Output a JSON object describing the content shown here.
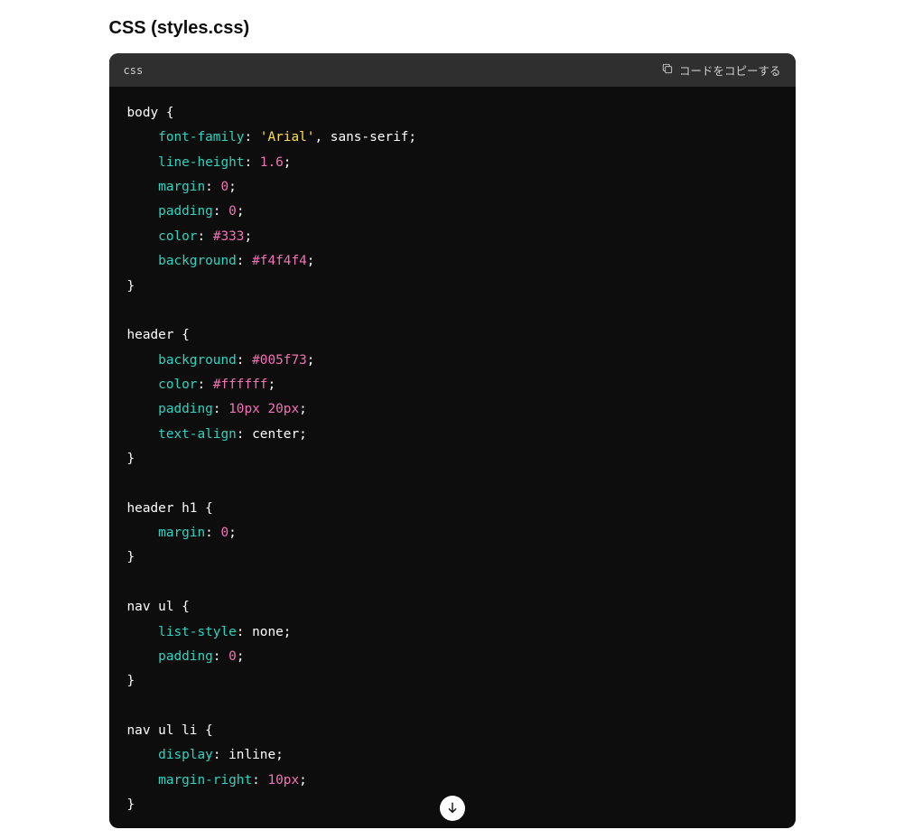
{
  "heading": "CSS (styles.css)",
  "codeblock": {
    "language": "css",
    "copy_label": "コードをコピーする",
    "lines": [
      [
        {
          "t": "sel",
          "v": "body {"
        }
      ],
      [
        {
          "t": "indent",
          "v": "    "
        },
        {
          "t": "prop",
          "v": "font-family"
        },
        {
          "t": "punc",
          "v": ": "
        },
        {
          "t": "str",
          "v": "'Arial'"
        },
        {
          "t": "punc",
          "v": ", sans-serif;"
        }
      ],
      [
        {
          "t": "indent",
          "v": "    "
        },
        {
          "t": "prop",
          "v": "line-height"
        },
        {
          "t": "punc",
          "v": ": "
        },
        {
          "t": "num",
          "v": "1.6"
        },
        {
          "t": "punc",
          "v": ";"
        }
      ],
      [
        {
          "t": "indent",
          "v": "    "
        },
        {
          "t": "prop",
          "v": "margin"
        },
        {
          "t": "punc",
          "v": ": "
        },
        {
          "t": "num",
          "v": "0"
        },
        {
          "t": "punc",
          "v": ";"
        }
      ],
      [
        {
          "t": "indent",
          "v": "    "
        },
        {
          "t": "prop",
          "v": "padding"
        },
        {
          "t": "punc",
          "v": ": "
        },
        {
          "t": "num",
          "v": "0"
        },
        {
          "t": "punc",
          "v": ";"
        }
      ],
      [
        {
          "t": "indent",
          "v": "    "
        },
        {
          "t": "prop",
          "v": "color"
        },
        {
          "t": "punc",
          "v": ": "
        },
        {
          "t": "num",
          "v": "#333"
        },
        {
          "t": "punc",
          "v": ";"
        }
      ],
      [
        {
          "t": "indent",
          "v": "    "
        },
        {
          "t": "prop",
          "v": "background"
        },
        {
          "t": "punc",
          "v": ": "
        },
        {
          "t": "num",
          "v": "#f4f4f4"
        },
        {
          "t": "punc",
          "v": ";"
        }
      ],
      [
        {
          "t": "sel",
          "v": "}"
        }
      ],
      [
        {
          "t": "blank",
          "v": " "
        }
      ],
      [
        {
          "t": "sel",
          "v": "header {"
        }
      ],
      [
        {
          "t": "indent",
          "v": "    "
        },
        {
          "t": "prop",
          "v": "background"
        },
        {
          "t": "punc",
          "v": ": "
        },
        {
          "t": "num",
          "v": "#005f73"
        },
        {
          "t": "punc",
          "v": ";"
        }
      ],
      [
        {
          "t": "indent",
          "v": "    "
        },
        {
          "t": "prop",
          "v": "color"
        },
        {
          "t": "punc",
          "v": ": "
        },
        {
          "t": "num",
          "v": "#ffffff"
        },
        {
          "t": "punc",
          "v": ";"
        }
      ],
      [
        {
          "t": "indent",
          "v": "    "
        },
        {
          "t": "prop",
          "v": "padding"
        },
        {
          "t": "punc",
          "v": ": "
        },
        {
          "t": "num",
          "v": "10px"
        },
        {
          "t": "punc",
          "v": " "
        },
        {
          "t": "num",
          "v": "20px"
        },
        {
          "t": "punc",
          "v": ";"
        }
      ],
      [
        {
          "t": "indent",
          "v": "    "
        },
        {
          "t": "prop",
          "v": "text-align"
        },
        {
          "t": "punc",
          "v": ": "
        },
        {
          "t": "val",
          "v": "center"
        },
        {
          "t": "punc",
          "v": ";"
        }
      ],
      [
        {
          "t": "sel",
          "v": "}"
        }
      ],
      [
        {
          "t": "blank",
          "v": " "
        }
      ],
      [
        {
          "t": "sel",
          "v": "header h1 {"
        }
      ],
      [
        {
          "t": "indent",
          "v": "    "
        },
        {
          "t": "prop",
          "v": "margin"
        },
        {
          "t": "punc",
          "v": ": "
        },
        {
          "t": "num",
          "v": "0"
        },
        {
          "t": "punc",
          "v": ";"
        }
      ],
      [
        {
          "t": "sel",
          "v": "}"
        }
      ],
      [
        {
          "t": "blank",
          "v": " "
        }
      ],
      [
        {
          "t": "sel",
          "v": "nav ul {"
        }
      ],
      [
        {
          "t": "indent",
          "v": "    "
        },
        {
          "t": "prop",
          "v": "list-style"
        },
        {
          "t": "punc",
          "v": ": "
        },
        {
          "t": "val",
          "v": "none"
        },
        {
          "t": "punc",
          "v": ";"
        }
      ],
      [
        {
          "t": "indent",
          "v": "    "
        },
        {
          "t": "prop",
          "v": "padding"
        },
        {
          "t": "punc",
          "v": ": "
        },
        {
          "t": "num",
          "v": "0"
        },
        {
          "t": "punc",
          "v": ";"
        }
      ],
      [
        {
          "t": "sel",
          "v": "}"
        }
      ],
      [
        {
          "t": "blank",
          "v": " "
        }
      ],
      [
        {
          "t": "sel",
          "v": "nav ul li {"
        }
      ],
      [
        {
          "t": "indent",
          "v": "    "
        },
        {
          "t": "prop",
          "v": "display"
        },
        {
          "t": "punc",
          "v": ": "
        },
        {
          "t": "val",
          "v": "inline"
        },
        {
          "t": "punc",
          "v": ";"
        }
      ],
      [
        {
          "t": "indent",
          "v": "    "
        },
        {
          "t": "prop",
          "v": "margin-right"
        },
        {
          "t": "punc",
          "v": ": "
        },
        {
          "t": "num",
          "v": "10px"
        },
        {
          "t": "punc",
          "v": ";"
        }
      ],
      [
        {
          "t": "sel",
          "v": "}"
        }
      ]
    ]
  }
}
